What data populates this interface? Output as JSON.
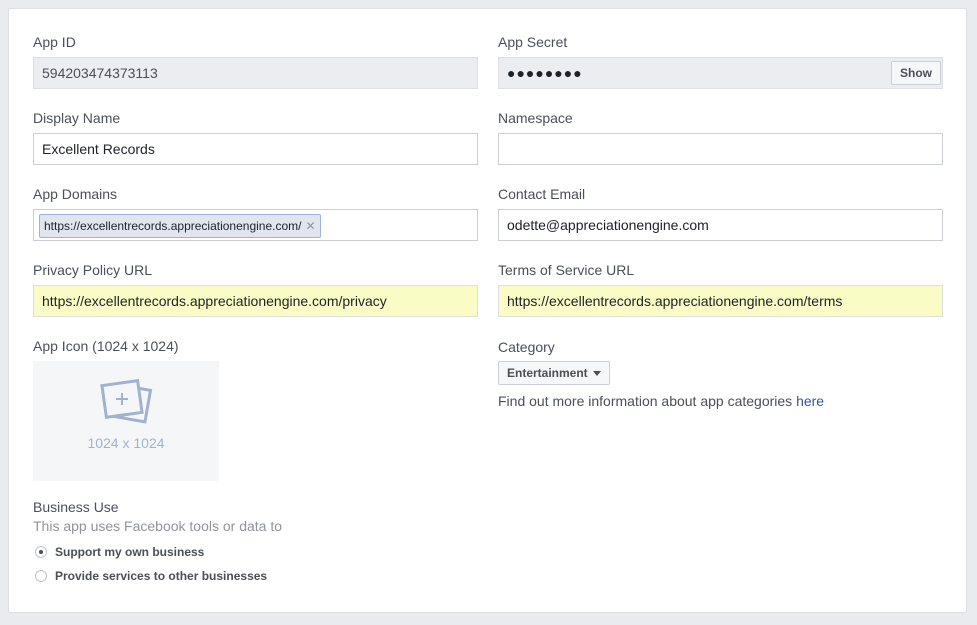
{
  "app_id": {
    "label": "App ID",
    "value": "594203474373113"
  },
  "app_secret": {
    "label": "App Secret",
    "value": "●●●●●●●●",
    "show_label": "Show"
  },
  "display_name": {
    "label": "Display Name",
    "value": "Excellent Records"
  },
  "namespace": {
    "label": "Namespace",
    "value": ""
  },
  "app_domains": {
    "label": "App Domains",
    "tokens": [
      "https://excellentrecords.appreciationengine.com/"
    ]
  },
  "contact_email": {
    "label": "Contact Email",
    "value": "odette@appreciationengine.com"
  },
  "privacy_policy": {
    "label": "Privacy Policy URL",
    "value": "https://excellentrecords.appreciationengine.com/privacy"
  },
  "terms_of_service": {
    "label": "Terms of Service URL",
    "value": "https://excellentrecords.appreciationengine.com/terms"
  },
  "app_icon": {
    "label": "App Icon (1024 x 1024)",
    "placeholder_text": "1024 x 1024"
  },
  "category": {
    "label": "Category",
    "selected": "Entertainment",
    "help_text": "Find out more information about app categories ",
    "help_link": "here"
  },
  "business_use": {
    "label": "Business Use",
    "subtext": "This app uses Facebook tools or data to",
    "options": [
      {
        "label": "Support my own business",
        "checked": true
      },
      {
        "label": "Provide services to other businesses",
        "checked": false
      }
    ]
  }
}
